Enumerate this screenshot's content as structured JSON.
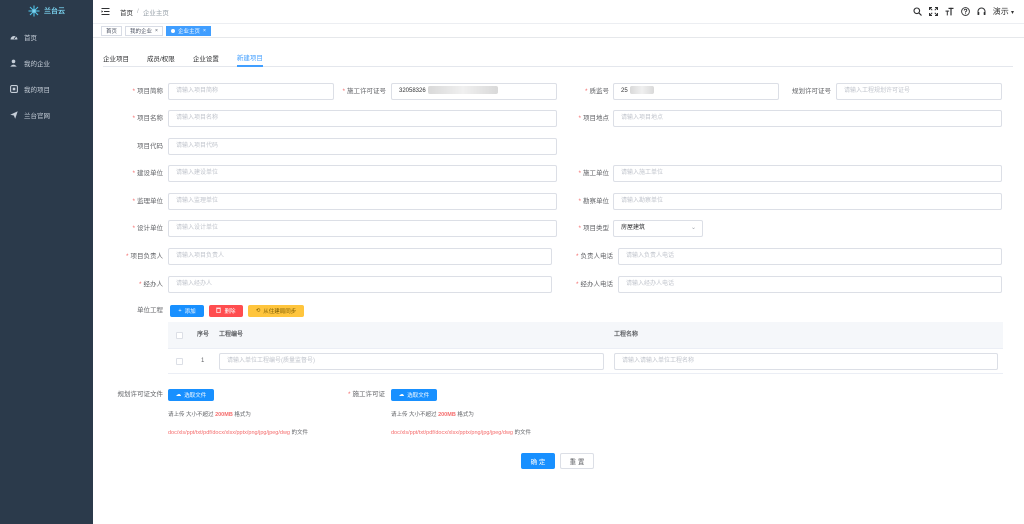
{
  "app": {
    "name": "兰台云"
  },
  "sidebar": {
    "items": [
      {
        "label": "首页",
        "icon": "dashboard-icon"
      },
      {
        "label": "我的企业",
        "icon": "user-icon"
      },
      {
        "label": "我的项目",
        "icon": "project-icon"
      },
      {
        "label": "兰台官网",
        "icon": "send-icon"
      }
    ]
  },
  "header": {
    "breadcrumb_home": "首页",
    "breadcrumb_sep": "/",
    "breadcrumb_current": "企业主页",
    "user": "演示",
    "user_caret": "▾"
  },
  "tags": [
    {
      "label": "首页"
    },
    {
      "label": "我的企业",
      "close": "×"
    },
    {
      "label": "企业主页",
      "close": "×"
    }
  ],
  "tabs": [
    "企业项目",
    "成员/权限",
    "企业设置",
    "新建项目"
  ],
  "form": {
    "project_short": {
      "label": "项目简称",
      "placeholder": "请输入项目简称"
    },
    "permit_no": {
      "label": "施工许可证号",
      "value": "32058326"
    },
    "supervision_no": {
      "label": "质监号",
      "value": "25"
    },
    "plan_permit_no": {
      "label": "规划许可证号",
      "placeholder": "请输入工程规划许可证号"
    },
    "project_name": {
      "label": "项目名称",
      "placeholder": "请输入项目名称"
    },
    "project_location": {
      "label": "项目地点",
      "placeholder": "请输入项目地点"
    },
    "project_code": {
      "label": "项目代码",
      "placeholder": "请输入项目代码"
    },
    "builder": {
      "label": "建设单位",
      "placeholder": "请输入建设单位"
    },
    "contractor": {
      "label": "施工单位",
      "placeholder": "请输入施工单位"
    },
    "supervisor": {
      "label": "监理单位",
      "placeholder": "请输入监理单位"
    },
    "surveyor": {
      "label": "勘察单位",
      "placeholder": "请输入勘察单位"
    },
    "designer": {
      "label": "设计单位",
      "placeholder": "请输入设计单位"
    },
    "project_type": {
      "label": "项目类型",
      "value": "房屋建筑"
    },
    "manager": {
      "label": "项目负责人",
      "placeholder": "请输入项目负责人"
    },
    "manager_phone": {
      "label": "负责人电话",
      "placeholder": "请输入负责人电话"
    },
    "handler": {
      "label": "经办人",
      "placeholder": "请输入经办人"
    },
    "handler_phone": {
      "label": "经办人电话",
      "placeholder": "请输入经办人电话"
    },
    "units_label": "单位工程",
    "add_btn": "添加",
    "delete_btn": "删除",
    "sync_btn": "从住建局同步"
  },
  "table": {
    "headers": [
      "序号",
      "工程编号",
      "工程名称"
    ],
    "rows": [
      {
        "index": "1",
        "code_placeholder": "请输入单位工程编号(质量监督号)",
        "name_placeholder": "请输入请输入单位工程名称"
      }
    ]
  },
  "uploads": {
    "plan_label": "规划许可证文件",
    "permit_label": "施工许可证",
    "choose_btn": "选取文件",
    "hint_prefix": "请上传 大小不超过",
    "hint_size": "200MB",
    "hint_suffix": "格式为",
    "types": "doc/xls/ppt/txt/pdf/docx/xlsx/pptx/png/jpg/jpeg/dwg",
    "types_tail": "的文件"
  },
  "actions": {
    "confirm": "确 定",
    "reset": "重 置"
  },
  "colors": {
    "sidebar": "#2b3a4b",
    "primary": "#1890ff",
    "danger": "#ff4d4f",
    "warning": "#ffc53d",
    "required": "#f56c6c"
  }
}
